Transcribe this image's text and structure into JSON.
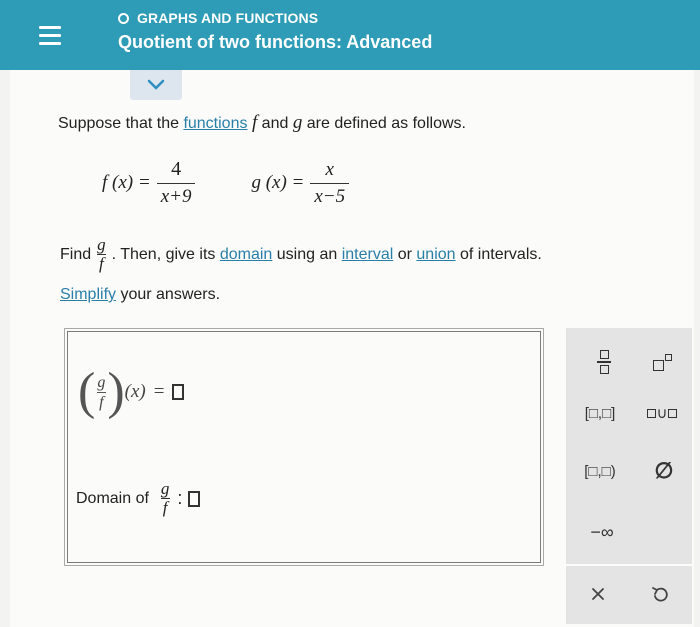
{
  "header": {
    "topic": "GRAPHS AND FUNCTIONS",
    "title": "Quotient of two functions: Advanced"
  },
  "problem": {
    "intro_before": "Suppose that the ",
    "functions_link": "functions",
    "f_var": "f",
    "and_text": " and ",
    "g_var": "g",
    "intro_after": " are defined as follows.",
    "f_lhs": "f (x) =",
    "f_num": "4",
    "f_den": "x+9",
    "g_lhs": "g (x) =",
    "g_num": "x",
    "g_den": "x−5",
    "find_word": "Find",
    "find_frac_num": "g",
    "find_frac_den": "f",
    "then_text": ". Then, give its ",
    "domain_link": "domain",
    "using_text": " using an ",
    "interval_link": "interval",
    "or_text": " or ",
    "union_link": "union",
    "of_intervals_text": " of intervals.",
    "simplify_link": "Simplify",
    "simplify_after": " your answers."
  },
  "answer": {
    "quotient_num": "g",
    "quotient_den": "f",
    "quotient_arg": "(x)",
    "equals": "=",
    "domain_label": "Domain of",
    "domain_frac_num": "g",
    "domain_frac_den": "f",
    "domain_colon": ":"
  },
  "palette": {
    "closed_interval": "[□,□]",
    "half_open_interval": "[□,□)",
    "neg_infinity": "−∞",
    "empty_set": "∅",
    "union": "∪"
  },
  "colors": {
    "header_bg": "#2e9cb6",
    "link": "#2a7fa8",
    "palette_bg": "#e4e4e4"
  }
}
